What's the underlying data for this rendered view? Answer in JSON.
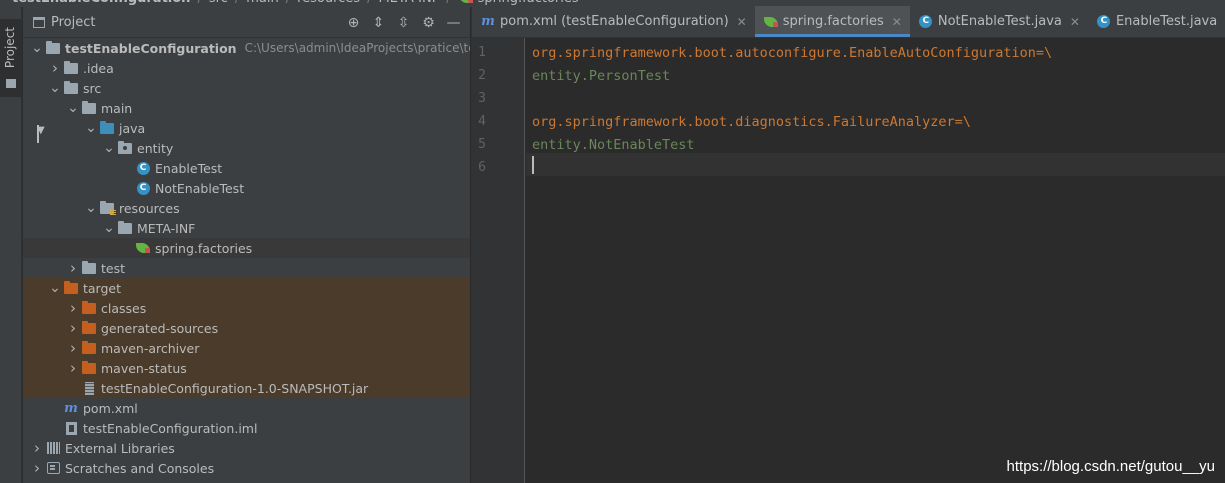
{
  "breadcrumb": [
    "testEnableConfiguration",
    "src",
    "main",
    "resources",
    "META-INF",
    "spring.factories"
  ],
  "stripe": {
    "label": "Project"
  },
  "project": {
    "title": "Project",
    "tree": [
      {
        "label": "testEnableConfiguration",
        "path": "C:\\Users\\admin\\IdeaProjects\\pratice\\testEn",
        "icon": "module-folder-icon",
        "depth": 0,
        "arrow": "down",
        "bold": true
      },
      {
        "label": ".idea",
        "icon": "folder-icon",
        "depth": 1,
        "arrow": "right"
      },
      {
        "label": "src",
        "icon": "folder-icon",
        "depth": 1,
        "arrow": "down"
      },
      {
        "label": "main",
        "icon": "folder-icon",
        "depth": 2,
        "arrow": "down"
      },
      {
        "label": "java",
        "icon": "source-folder-icon",
        "depth": 3,
        "arrow": "down"
      },
      {
        "label": "entity",
        "icon": "package-icon",
        "depth": 4,
        "arrow": "down"
      },
      {
        "label": "EnableTest",
        "icon": "class-icon",
        "depth": 5,
        "arrow": "none"
      },
      {
        "label": "NotEnableTest",
        "icon": "class-icon",
        "depth": 5,
        "arrow": "none"
      },
      {
        "label": "resources",
        "icon": "resources-folder-icon",
        "depth": 3,
        "arrow": "down"
      },
      {
        "label": "META-INF",
        "icon": "folder-icon",
        "depth": 4,
        "arrow": "down"
      },
      {
        "label": "spring.factories",
        "icon": "spring-icon",
        "depth": 5,
        "arrow": "none",
        "selected": true
      },
      {
        "label": "test",
        "icon": "folder-icon",
        "depth": 2,
        "arrow": "right"
      },
      {
        "label": "target",
        "icon": "excluded-folder-icon",
        "depth": 1,
        "arrow": "down",
        "excluded": true
      },
      {
        "label": "classes",
        "icon": "excluded-folder-icon",
        "depth": 2,
        "arrow": "right",
        "excluded": true
      },
      {
        "label": "generated-sources",
        "icon": "excluded-folder-icon",
        "depth": 2,
        "arrow": "right",
        "excluded": true
      },
      {
        "label": "maven-archiver",
        "icon": "excluded-folder-icon",
        "depth": 2,
        "arrow": "right",
        "excluded": true
      },
      {
        "label": "maven-status",
        "icon": "excluded-folder-icon",
        "depth": 2,
        "arrow": "right",
        "excluded": true
      },
      {
        "label": "testEnableConfiguration-1.0-SNAPSHOT.jar",
        "icon": "jar-icon",
        "depth": 2,
        "arrow": "none",
        "excluded": true
      },
      {
        "label": "pom.xml",
        "icon": "maven-icon",
        "depth": 1,
        "arrow": "none"
      },
      {
        "label": "testEnableConfiguration.iml",
        "icon": "iml-icon",
        "depth": 1,
        "arrow": "none"
      },
      {
        "label": "External Libraries",
        "icon": "libraries-icon",
        "depth": 0,
        "arrow": "right"
      },
      {
        "label": "Scratches and Consoles",
        "icon": "scratches-icon",
        "depth": 0,
        "arrow": "right"
      }
    ]
  },
  "editor": {
    "tabs": [
      {
        "label": "pom.xml (testEnableConfiguration)",
        "icon": "maven-icon",
        "active": false
      },
      {
        "label": "spring.factories",
        "icon": "spring-icon",
        "active": true
      },
      {
        "label": "NotEnableTest.java",
        "icon": "class-icon",
        "active": false
      },
      {
        "label": "EnableTest.java",
        "icon": "class-icon",
        "active": false
      }
    ],
    "lines": [
      {
        "num": "1",
        "key": "org.springframework.boot.autoconfigure.EnableAutoConfiguration",
        "sep": "=\\",
        "val": ""
      },
      {
        "num": "2",
        "key": "",
        "sep": "",
        "val": "entity.PersonTest"
      },
      {
        "num": "3",
        "key": "",
        "sep": "",
        "val": ""
      },
      {
        "num": "4",
        "key": "org.springframework.boot.diagnostics.FailureAnalyzer",
        "sep": "=\\",
        "val": ""
      },
      {
        "num": "5",
        "key": "",
        "sep": "",
        "val": "entity.NotEnableTest"
      },
      {
        "num": "6",
        "key": "",
        "sep": "",
        "val": ""
      }
    ]
  },
  "watermark": "https://blog.csdn.net/gutou__yu",
  "colors": {
    "accent": "#4a88c7",
    "keyword": "#cc7832",
    "string": "#6a8759",
    "excluded_bg": "#4b3b2a"
  }
}
